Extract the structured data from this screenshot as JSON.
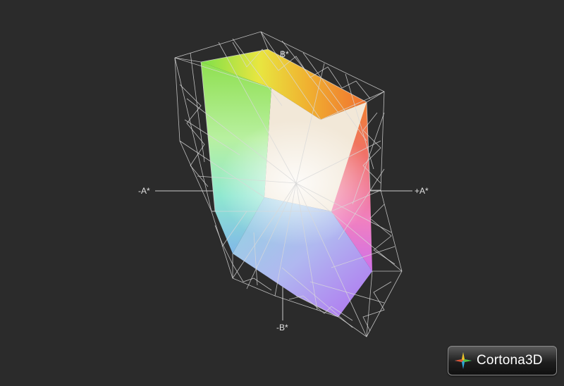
{
  "axes": {
    "minus_a": "-A*",
    "plus_a": "+A*",
    "plus_b": "B*",
    "minus_b": "-B*"
  },
  "logo": {
    "text": "Cortona3D",
    "icon": "cortona-star-icon"
  },
  "colors": {
    "background": "#2b2b2b",
    "wireframe": "#d8d8d8",
    "axis": "#c8c8c8"
  }
}
